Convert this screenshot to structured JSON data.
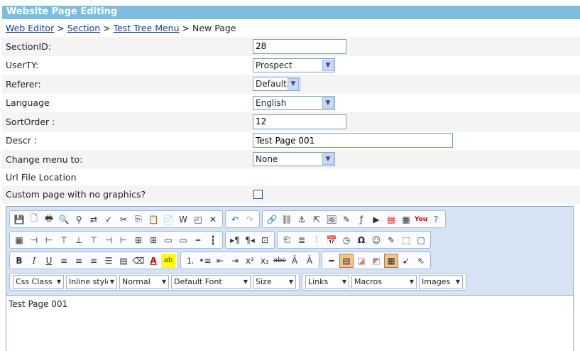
{
  "title": "Website Page Editing",
  "breadcrumb": {
    "links": [
      "Web Editor",
      "Section",
      "Test Tree Menu"
    ],
    "separator": ">",
    "current": "New Page"
  },
  "form": {
    "section_id": {
      "label": "SectionID:",
      "value": "28"
    },
    "user_type": {
      "label": "UserTY:",
      "value": "Prospect"
    },
    "referer": {
      "label": "Referer:",
      "value": "Default"
    },
    "language": {
      "label": "Language",
      "value": "English"
    },
    "sort_order": {
      "label": "SortOrder :",
      "value": "12"
    },
    "descr": {
      "label": "Descr :",
      "value": "Test Page 001"
    },
    "change_menu": {
      "label": "Change menu to:",
      "value": "None"
    },
    "url_location": {
      "label": "Url File Location",
      "value": ""
    },
    "custom_page": {
      "label": "Custom page with no graphics?",
      "checked": false
    }
  },
  "editor": {
    "dropdowns": {
      "css_class": "Css Class",
      "inline_style": "Inline style",
      "paragraph": "Normal",
      "font": "Default Font",
      "size": "Size",
      "links": "Links",
      "macros": "Macros",
      "images": "Images"
    },
    "content": "Test Page 001"
  }
}
